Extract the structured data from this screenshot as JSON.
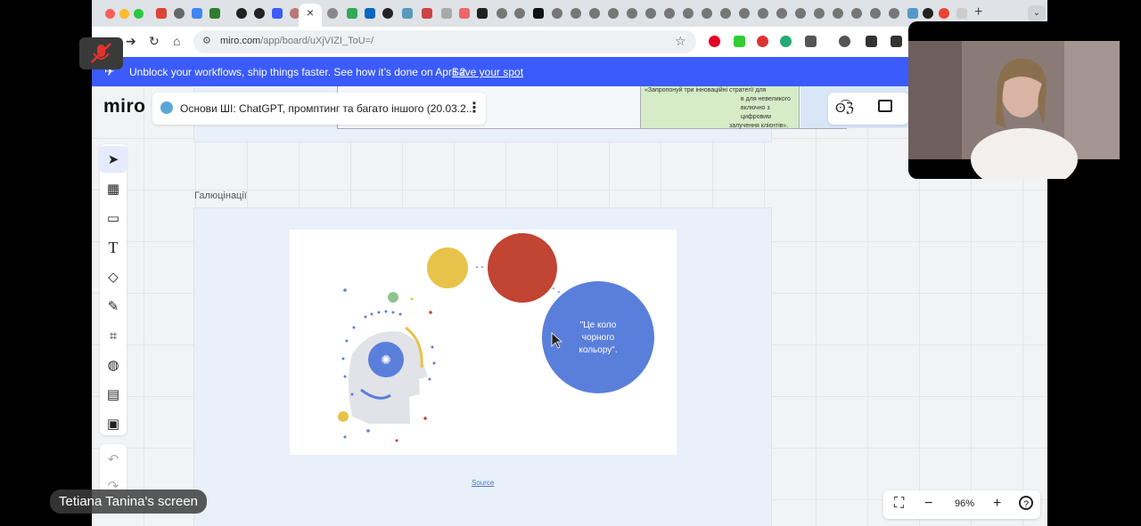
{
  "browser": {
    "url_host": "miro.com",
    "url_path": "/app/board/uXjVIZI_ToU=/",
    "tab_close_glyph": "×",
    "new_tab_glyph": "+",
    "tab_menu_glyph": "⌄"
  },
  "banner": {
    "text": "Unblock your workflows, ship things faster. See how it’s done on April 2.",
    "link": "Save your spot",
    "color": "#3b5bfd"
  },
  "miro": {
    "logo": "miro",
    "board_name": "Основи ШІ: ChatGPT, промптинг та багато іншого (20.03.2...",
    "board_menu_glyph": "⋮",
    "collab_glyph": "ʘ͡ℨ"
  },
  "top_table": {
    "green_cell_lines": [
      "«Запропонуй три інноваційні стратегії для",
      "в для невеликого",
      "включно з цифровим",
      "залучення клієнтів»."
    ]
  },
  "frame": {
    "title": "Галюцінації",
    "source_link": "Source",
    "blue_circle_text": [
      "\"Це коло",
      "чорного",
      "кольору\"."
    ],
    "colors": {
      "yellow": "#e7c34a",
      "red": "#c24433",
      "blue": "#5a7fdb",
      "green": "#8fc58c"
    }
  },
  "zoom": {
    "value": "96%",
    "minus": "−",
    "plus": "+",
    "help": "?"
  },
  "meeting": {
    "screen_label": "Tetiana Tanina's screen"
  }
}
